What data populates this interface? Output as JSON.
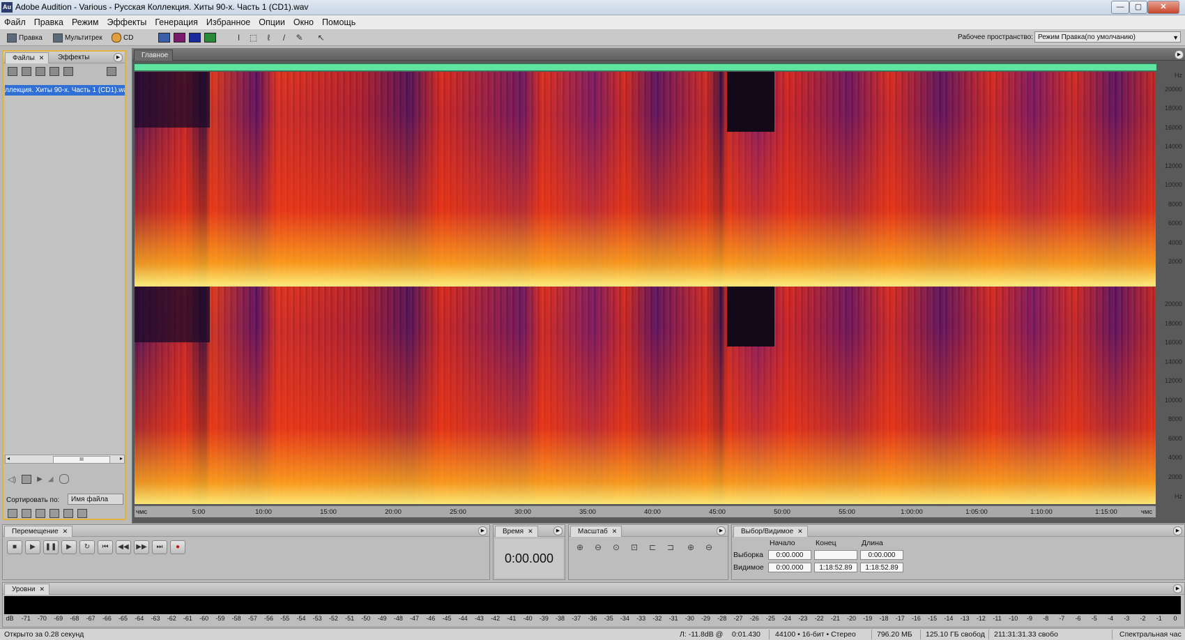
{
  "window": {
    "app_icon": "Au",
    "title": "Adobe Audition - Various - Русская Коллекция. Хиты 90-х. Часть 1 (CD1).wav",
    "minimize": "—",
    "maximize": "▢",
    "close": "✕"
  },
  "menu": [
    "Файл",
    "Правка",
    "Режим",
    "Эффекты",
    "Генерация",
    "Избранное",
    "Опции",
    "Окно",
    "Помощь"
  ],
  "toolbar": {
    "edit_mode": "Правка",
    "multitrack_mode": "Мультитрек",
    "cd_mode": "CD",
    "workspace_label": "Рабочее пространство:",
    "workspace_value": "Режим Правка(по умолчанию)"
  },
  "files_panel": {
    "tab_files": "Файлы",
    "tab_effects": "Эффекты",
    "file_entry": "ллекция. Хиты 90-х. Часть 1 (CD1).wav",
    "scroll_thumb": "III",
    "sort_label": "Сортировать по:",
    "sort_value": "Имя файла"
  },
  "main_panel": {
    "tab": "Главное",
    "freq_unit": "Hz",
    "freq_ticks": [
      "20000",
      "18000",
      "16000",
      "14000",
      "12000",
      "10000",
      "8000",
      "6000",
      "4000",
      "2000"
    ],
    "time_ticks": [
      "чмс",
      "5:00",
      "10:00",
      "15:00",
      "20:00",
      "25:00",
      "30:00",
      "35:00",
      "40:00",
      "45:00",
      "50:00",
      "55:00",
      "1:00:00",
      "1:05:00",
      "1:10:00",
      "1:15:00",
      "чмс"
    ]
  },
  "transport_panel": {
    "tab": "Перемещение",
    "buttons": [
      "■",
      "▶",
      "❚❚",
      "▶",
      "↻",
      "⏮",
      "◀◀",
      "▶▶",
      "⏭",
      "●"
    ]
  },
  "time_panel": {
    "tab": "Время",
    "display": "0:00.000"
  },
  "zoom_panel": {
    "tab": "Масштаб"
  },
  "selection_panel": {
    "tab": "Выбор/Видимое",
    "col_start": "Начало",
    "col_end": "Конец",
    "col_length": "Длина",
    "row_selection": "Выборка",
    "row_view": "Видимое",
    "sel_start": "0:00.000",
    "sel_end": "",
    "sel_length": "0:00.000",
    "view_start": "0:00.000",
    "view_end": "1:18:52.89",
    "view_length": "1:18:52.89"
  },
  "levels_panel": {
    "tab": "Уровни",
    "scale": [
      "dB",
      "-71",
      "-70",
      "-69",
      "-68",
      "-67",
      "-66",
      "-65",
      "-64",
      "-63",
      "-62",
      "-61",
      "-60",
      "-59",
      "-58",
      "-57",
      "-56",
      "-55",
      "-54",
      "-53",
      "-52",
      "-51",
      "-50",
      "-49",
      "-48",
      "-47",
      "-46",
      "-45",
      "-44",
      "-43",
      "-42",
      "-41",
      "-40",
      "-39",
      "-38",
      "-37",
      "-36",
      "-35",
      "-34",
      "-33",
      "-32",
      "-31",
      "-30",
      "-29",
      "-28",
      "-27",
      "-26",
      "-25",
      "-24",
      "-23",
      "-22",
      "-21",
      "-20",
      "-19",
      "-18",
      "-17",
      "-16",
      "-15",
      "-14",
      "-13",
      "-12",
      "-11",
      "-10",
      "-9",
      "-8",
      "-7",
      "-6",
      "-5",
      "-4",
      "-3",
      "-2",
      "-1",
      "0"
    ]
  },
  "status": {
    "opened": "Открыто за 0.28 секунд",
    "level": "Л: -11.8dB @",
    "cursor": "0:01.430",
    "format": "44100 • 16-бит • Стерео",
    "size": "796.20 МБ",
    "free_space": "125.10 ГБ свобод",
    "free_time": "211:31:31.33 свобо",
    "view": "Спектральная час"
  },
  "colors": {
    "selection_blue": "#2f6fd6",
    "overview_green": "#5fe3a0",
    "panel_highlight": "#e3b23c",
    "record_red": "#d01010"
  }
}
